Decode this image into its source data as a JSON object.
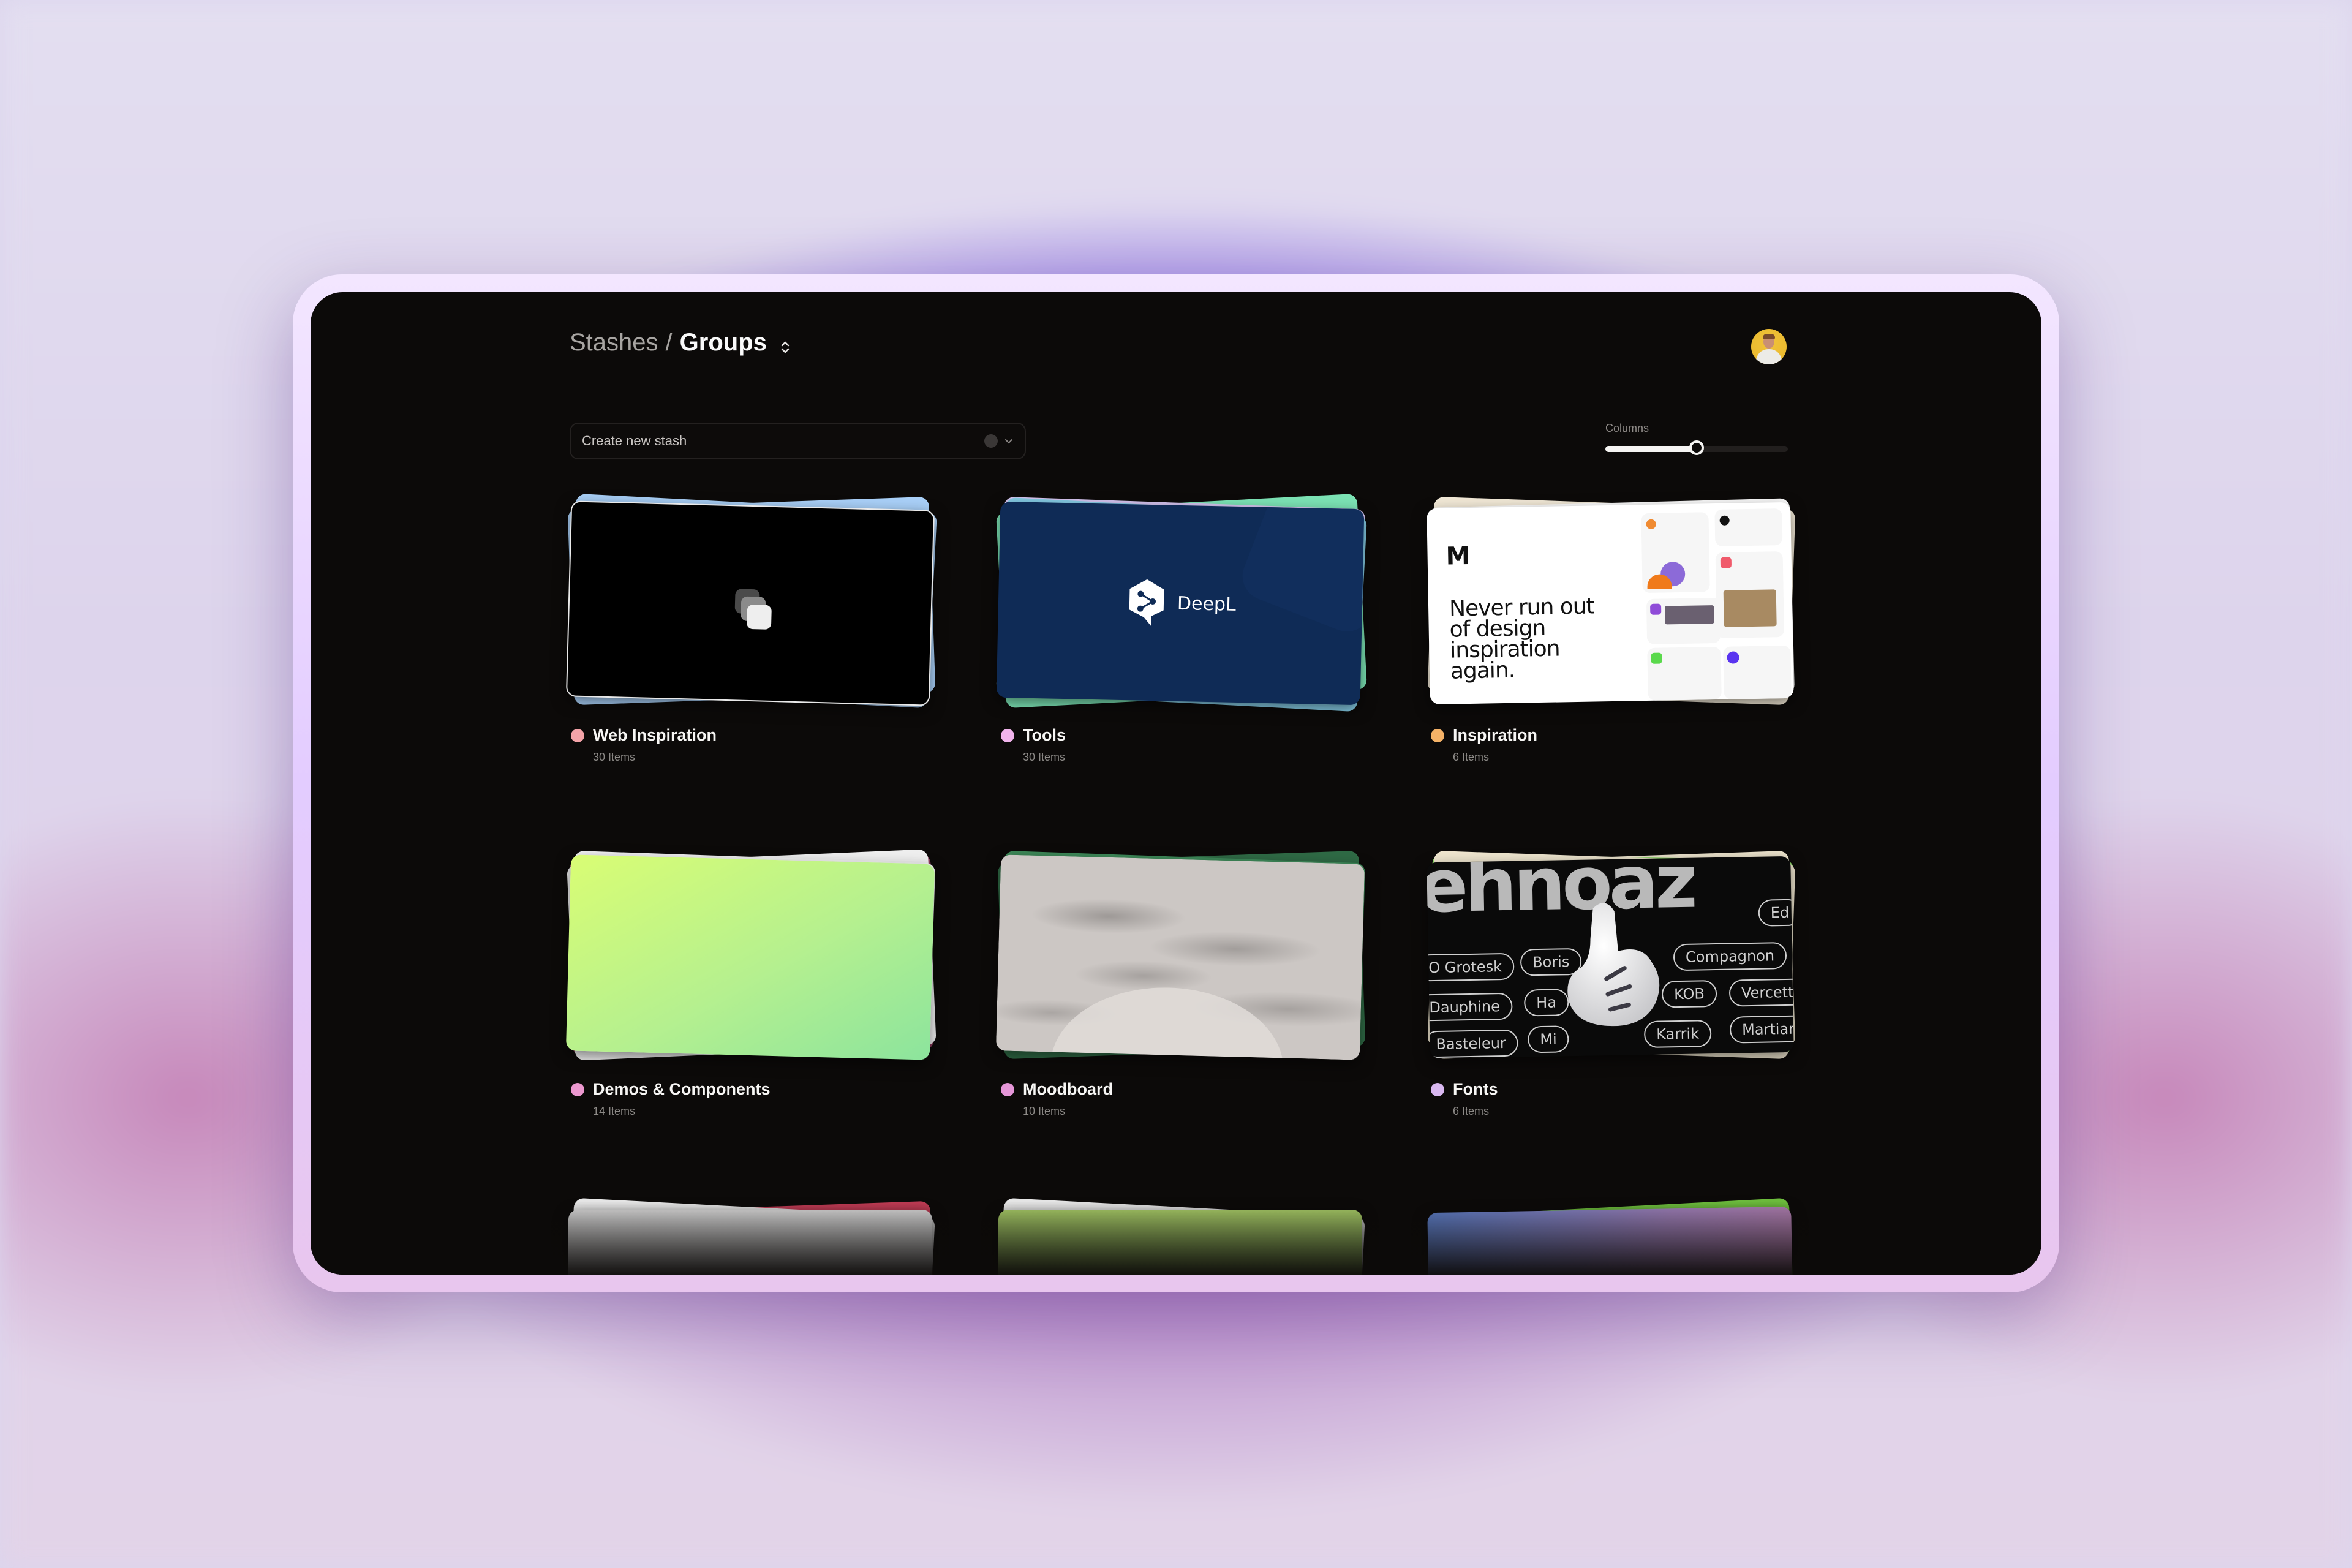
{
  "breadcrumb": {
    "root": "Stashes",
    "separator": "/",
    "current": "Groups"
  },
  "toolbar": {
    "create_placeholder": "Create new stash",
    "columns_label": "Columns",
    "columns_slider_value": 0.5
  },
  "user": {
    "avatar_alt": "User avatar"
  },
  "groups": [
    {
      "name": "Web Inspiration",
      "count": "30 Items",
      "color": "#f4a3a8",
      "thumb": "web"
    },
    {
      "name": "Tools",
      "count": "30 Items",
      "color": "#f1b4ec",
      "thumb": "deepl",
      "thumb_text": "DeepL"
    },
    {
      "name": "Inspiration",
      "count": "6 Items",
      "color": "#f5b267",
      "thumb": "insp",
      "thumb_text": "Never run out of design inspiration again."
    },
    {
      "name": "Demos & Components",
      "count": "14 Items",
      "color": "#ec98cf",
      "thumb": "demo"
    },
    {
      "name": "Moodboard",
      "count": "10 Items",
      "color": "#e596d8",
      "thumb": "mood"
    },
    {
      "name": "Fonts",
      "count": "6 Items",
      "color": "#d9b8f0",
      "thumb": "fonts",
      "font_tags": [
        "O Grotesk",
        "Boris",
        "Compagnon",
        "Dauphine",
        "Ha",
        "KOB",
        "Vercetti",
        "Basteleur",
        "Mi",
        "Karrik",
        "Martian",
        "Ed"
      ]
    }
  ]
}
